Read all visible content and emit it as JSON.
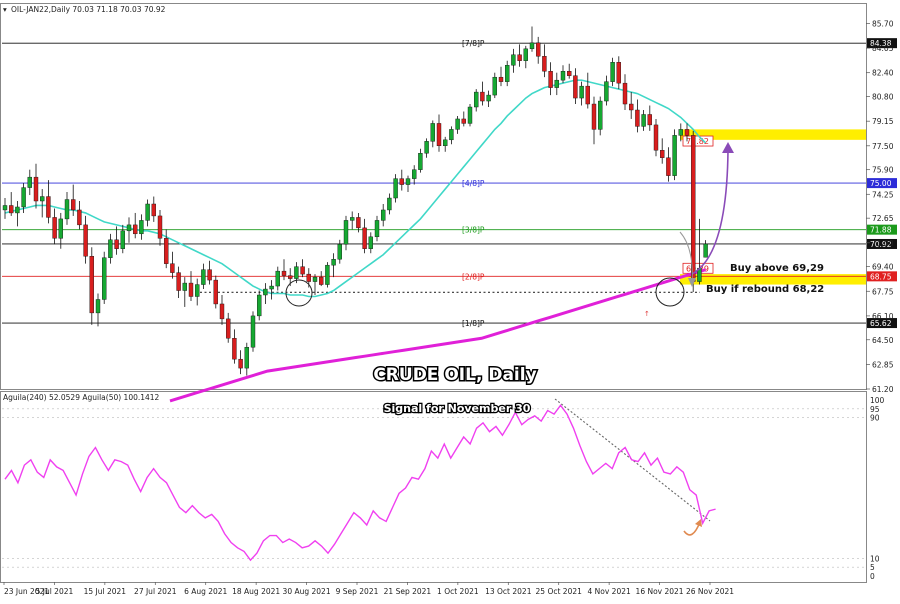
{
  "header": {
    "symbol_line": "OIL-JAN22,Daily  70.03 71.18 70.03 70.92",
    "indicator_line": "Aguila(240) 52.0529  Aguila(50) 100.1412"
  },
  "overlay": {
    "title": "CRUDE OIL, Daily",
    "subtitle": "Signal for November 30"
  },
  "notes": {
    "buy_above": "Buy above 69,29",
    "buy_rebound": "Buy if rebound 68,22"
  },
  "colors": {
    "bull": "#16a832",
    "bear": "#d81e1e",
    "wick": "#111111",
    "ma_short": "#40d8c8",
    "ma_long": "#e020d8",
    "osc": "#f040f0",
    "highlight": "#ffee00",
    "murray_blue": "#2c2cd8",
    "murray_green": "#1b9a1b",
    "murray_red": "#e02020",
    "arrow_purple": "#8a4bb8",
    "arrow_orange": "#e08a50"
  },
  "chart_data": [
    {
      "type": "candlestick",
      "title": "CRUDE OIL, Daily",
      "symbol": "OIL-JAN22",
      "timeframe": "Daily",
      "ylim": [
        61.2,
        86.2
      ],
      "y_ticks": [
        85.7,
        84.05,
        82.4,
        80.8,
        79.15,
        77.5,
        75.9,
        74.25,
        72.65,
        71.0,
        69.4,
        67.75,
        66.1,
        64.5,
        62.85,
        61.2
      ],
      "x_tick_labels": [
        "23 Jun 2021",
        "5 Jul 2021",
        "15 Jul 2021",
        "27 Jul 2021",
        "6 Aug 2021",
        "18 Aug 2021",
        "30 Aug 2021",
        "9 Sep 2021",
        "21 Sep 2021",
        "1 Oct 2021",
        "13 Oct 2021",
        "25 Oct 2021",
        "4 Nov 2021",
        "16 Nov 2021",
        "26 Nov 2021"
      ],
      "candles": [
        [
          73.2,
          74.0,
          72.6,
          73.5
        ],
        [
          73.5,
          74.4,
          72.8,
          73.0
        ],
        [
          73.0,
          73.8,
          72.1,
          73.4
        ],
        [
          73.4,
          75.0,
          73.0,
          74.7
        ],
        [
          74.7,
          75.9,
          74.2,
          75.4
        ],
        [
          75.4,
          76.3,
          73.3,
          73.8
        ],
        [
          73.8,
          74.6,
          72.7,
          74.1
        ],
        [
          74.1,
          75.2,
          72.3,
          72.7
        ],
        [
          72.7,
          73.3,
          70.9,
          71.3
        ],
        [
          71.3,
          73.0,
          70.6,
          72.6
        ],
        [
          72.6,
          74.4,
          72.2,
          73.9
        ],
        [
          73.9,
          74.9,
          72.8,
          73.2
        ],
        [
          73.2,
          73.8,
          71.9,
          72.2
        ],
        [
          72.2,
          72.8,
          69.6,
          70.1
        ],
        [
          70.1,
          70.7,
          65.5,
          66.3
        ],
        [
          66.3,
          67.6,
          65.4,
          67.2
        ],
        [
          67.2,
          70.4,
          66.9,
          70.0
        ],
        [
          70.0,
          71.6,
          69.6,
          71.2
        ],
        [
          71.2,
          72.1,
          70.2,
          70.6
        ],
        [
          70.6,
          72.2,
          70.3,
          71.8
        ],
        [
          71.8,
          72.7,
          71.0,
          72.2
        ],
        [
          72.2,
          73.0,
          71.3,
          71.6
        ],
        [
          71.6,
          72.9,
          71.2,
          72.5
        ],
        [
          72.5,
          73.9,
          72.1,
          73.6
        ],
        [
          73.6,
          74.1,
          72.4,
          72.8
        ],
        [
          72.8,
          73.2,
          70.8,
          71.3
        ],
        [
          71.3,
          71.9,
          69.3,
          69.6
        ],
        [
          69.6,
          70.4,
          68.6,
          69.0
        ],
        [
          69.0,
          69.4,
          67.3,
          67.8
        ],
        [
          67.8,
          68.7,
          66.7,
          68.3
        ],
        [
          68.3,
          69.1,
          67.1,
          67.4
        ],
        [
          67.4,
          68.6,
          66.8,
          68.2
        ],
        [
          68.2,
          69.6,
          67.9,
          69.2
        ],
        [
          69.2,
          69.8,
          68.2,
          68.5
        ],
        [
          68.5,
          68.8,
          66.6,
          66.9
        ],
        [
          66.9,
          67.5,
          65.5,
          65.9
        ],
        [
          65.9,
          66.3,
          64.3,
          64.6
        ],
        [
          64.6,
          65.2,
          62.9,
          63.2
        ],
        [
          63.2,
          63.8,
          62.2,
          62.6
        ],
        [
          62.6,
          64.3,
          62.1,
          64.0
        ],
        [
          64.0,
          66.4,
          63.7,
          66.1
        ],
        [
          66.1,
          67.8,
          65.8,
          67.5
        ],
        [
          67.5,
          68.3,
          66.9,
          67.9
        ],
        [
          67.9,
          68.5,
          67.2,
          68.1
        ],
        [
          68.1,
          69.4,
          67.8,
          69.1
        ],
        [
          69.1,
          69.9,
          68.5,
          68.8
        ],
        [
          68.8,
          69.3,
          68.1,
          68.6
        ],
        [
          68.6,
          69.7,
          68.3,
          69.4
        ],
        [
          69.4,
          69.9,
          68.7,
          68.9
        ],
        [
          68.9,
          69.3,
          68.0,
          68.4
        ],
        [
          68.4,
          68.9,
          67.5,
          68.7
        ],
        [
          68.7,
          69.1,
          68.1,
          68.2
        ],
        [
          68.2,
          69.7,
          68.0,
          69.5
        ],
        [
          69.5,
          70.3,
          68.7,
          69.9
        ],
        [
          69.9,
          71.2,
          69.6,
          70.9
        ],
        [
          70.9,
          72.8,
          70.5,
          72.5
        ],
        [
          72.5,
          73.1,
          71.9,
          72.7
        ],
        [
          72.7,
          73.0,
          71.7,
          72.0
        ],
        [
          72.0,
          72.6,
          70.3,
          70.6
        ],
        [
          70.6,
          71.7,
          70.3,
          71.4
        ],
        [
          71.4,
          72.8,
          71.1,
          72.5
        ],
        [
          72.5,
          73.6,
          72.1,
          73.2
        ],
        [
          73.2,
          74.3,
          72.9,
          74.0
        ],
        [
          74.0,
          75.6,
          73.7,
          75.3
        ],
        [
          75.3,
          75.9,
          74.5,
          74.9
        ],
        [
          74.9,
          75.5,
          74.4,
          75.3
        ],
        [
          75.3,
          76.2,
          74.9,
          75.9
        ],
        [
          75.9,
          77.3,
          75.7,
          77.0
        ],
        [
          77.0,
          78.0,
          76.7,
          77.8
        ],
        [
          77.8,
          79.2,
          77.4,
          79.0
        ],
        [
          79.0,
          79.6,
          77.1,
          77.5
        ],
        [
          77.5,
          78.1,
          77.1,
          77.9
        ],
        [
          77.9,
          78.8,
          77.6,
          78.6
        ],
        [
          78.6,
          79.5,
          78.3,
          79.3
        ],
        [
          79.3,
          79.8,
          78.8,
          79.0
        ],
        [
          79.0,
          80.3,
          78.8,
          80.1
        ],
        [
          80.1,
          81.3,
          79.8,
          81.1
        ],
        [
          81.1,
          81.8,
          80.2,
          80.5
        ],
        [
          80.5,
          81.2,
          80.1,
          80.9
        ],
        [
          80.9,
          82.4,
          80.7,
          82.1
        ],
        [
          82.1,
          82.8,
          81.5,
          81.8
        ],
        [
          81.8,
          83.2,
          81.5,
          82.9
        ],
        [
          82.9,
          84.0,
          82.4,
          83.6
        ],
        [
          83.6,
          84.3,
          82.8,
          83.2
        ],
        [
          83.2,
          84.2,
          82.7,
          84.0
        ],
        [
          84.0,
          85.5,
          83.8,
          84.4
        ],
        [
          84.4,
          84.8,
          83.0,
          83.5
        ],
        [
          83.5,
          84.3,
          82.1,
          82.5
        ],
        [
          82.5,
          83.1,
          80.9,
          81.4
        ],
        [
          81.4,
          82.4,
          80.9,
          81.9
        ],
        [
          81.9,
          82.9,
          81.7,
          82.5
        ],
        [
          82.5,
          83.0,
          82.0,
          82.2
        ],
        [
          82.2,
          82.7,
          80.3,
          80.7
        ],
        [
          80.7,
          81.8,
          80.2,
          81.5
        ],
        [
          81.5,
          82.4,
          80.0,
          80.3
        ],
        [
          80.3,
          80.8,
          77.6,
          78.6
        ],
        [
          78.6,
          80.8,
          78.2,
          80.5
        ],
        [
          80.5,
          82.2,
          80.2,
          81.8
        ],
        [
          81.8,
          83.4,
          81.5,
          83.1
        ],
        [
          83.1,
          83.5,
          81.3,
          81.7
        ],
        [
          81.7,
          82.3,
          79.9,
          80.3
        ],
        [
          80.3,
          81.1,
          79.3,
          79.9
        ],
        [
          79.9,
          80.6,
          78.4,
          78.8
        ],
        [
          78.8,
          79.9,
          78.5,
          79.6
        ],
        [
          79.6,
          80.2,
          78.5,
          78.9
        ],
        [
          78.9,
          79.3,
          76.8,
          77.2
        ],
        [
          77.2,
          78.0,
          76.3,
          76.7
        ],
        [
          76.7,
          77.4,
          75.1,
          75.5
        ],
        [
          75.5,
          78.6,
          75.2,
          78.2
        ],
        [
          78.2,
          79.0,
          77.8,
          78.6
        ],
        [
          78.6,
          79.0,
          77.8,
          78.2
        ],
        [
          78.2,
          78.5,
          67.7,
          68.4
        ],
        [
          68.4,
          72.6,
          68.2,
          69.3
        ],
        [
          70.03,
          71.18,
          70.03,
          70.92
        ]
      ],
      "ma_short": [
        73.0,
        73.1,
        73.2,
        73.3,
        73.4,
        73.5,
        73.5,
        73.5,
        73.4,
        73.3,
        73.2,
        73.2,
        73.1,
        73.0,
        72.8,
        72.6,
        72.4,
        72.3,
        72.2,
        72.1,
        72.0,
        71.9,
        71.8,
        71.8,
        71.7,
        71.6,
        71.4,
        71.2,
        71.0,
        70.8,
        70.6,
        70.4,
        70.2,
        70.0,
        69.8,
        69.6,
        69.3,
        69.0,
        68.7,
        68.4,
        68.1,
        67.9,
        67.7,
        67.6,
        67.6,
        67.6,
        67.5,
        67.5,
        67.5,
        67.4,
        67.4,
        67.5,
        67.6,
        67.8,
        68.1,
        68.4,
        68.7,
        69.0,
        69.3,
        69.6,
        69.9,
        70.2,
        70.6,
        71.0,
        71.4,
        71.8,
        72.2,
        72.6,
        73.1,
        73.6,
        74.1,
        74.6,
        75.1,
        75.6,
        76.1,
        76.6,
        77.1,
        77.6,
        78.1,
        78.6,
        79.0,
        79.5,
        79.9,
        80.3,
        80.7,
        81.0,
        81.2,
        81.4,
        81.5,
        81.6,
        81.7,
        81.8,
        81.9,
        81.9,
        81.8,
        81.7,
        81.6,
        81.5,
        81.4,
        81.3,
        81.2,
        81.1,
        81.0,
        80.8,
        80.6,
        80.4,
        80.2,
        80.0,
        79.7,
        79.4,
        79.0,
        78.6,
        78.1,
        77.7
      ],
      "ma_long": [
        60.4,
        60.6,
        60.8,
        61.0,
        61.2,
        61.4,
        61.6,
        61.8,
        62.0,
        62.2,
        62.4,
        62.5,
        62.6,
        62.7,
        62.8,
        62.9,
        63.0,
        63.1,
        63.2,
        63.3,
        63.4,
        63.5,
        63.6,
        63.7,
        63.8,
        63.9,
        64.0,
        64.1,
        64.2,
        64.3,
        64.4,
        64.5,
        64.6,
        64.8,
        65.0,
        65.2,
        65.4,
        65.6,
        65.8,
        66.0,
        66.2,
        66.4,
        66.6,
        66.8,
        67.0,
        67.2,
        67.4,
        67.6,
        67.8,
        68.0,
        68.2,
        68.4,
        68.6,
        68.8,
        69.0,
        69.2
      ],
      "horizontal_levels": [
        {
          "label": "[7/8]P",
          "price": 84.38,
          "tag": "84.38",
          "color": "#111111"
        },
        {
          "label": "[4/8]P",
          "price": 75.0,
          "tag": "75.00",
          "color": "#2c2cd8"
        },
        {
          "label": "[3/8]P",
          "price": 71.88,
          "tag": "71.88",
          "color": "#1b9a1b"
        },
        {
          "label": "",
          "price": 70.92,
          "tag": "70.92",
          "color": "#111111"
        },
        {
          "label": "[2/8]P",
          "price": 68.75,
          "tag": "68.75",
          "color": "#e02020"
        },
        {
          "label": "[1/8]P",
          "price": 65.62,
          "tag": "65.62",
          "color": "#111111"
        }
      ],
      "annotations": [
        {
          "text": "77.82",
          "price": 77.82,
          "color": "#e02020"
        },
        {
          "text": "69.29",
          "price": 69.29,
          "color": "#e02020"
        },
        {
          "text": "Buy above 69,29",
          "price": 69.29
        },
        {
          "text": "Buy if rebound 68,22",
          "price": 68.22
        }
      ],
      "highlight_zones": [
        {
          "from": 77.9,
          "to": 78.6
        },
        {
          "from": 68.2,
          "to": 68.9
        }
      ]
    },
    {
      "type": "line",
      "title": "Aguila(240) 52.0529  Aguila(50) 100.1412",
      "ylim": [
        0,
        100
      ],
      "y_ticks": [
        100,
        95,
        90,
        10,
        5,
        0
      ],
      "values": [
        55,
        60,
        53,
        63,
        66,
        59,
        56,
        66,
        62,
        60,
        53,
        46,
        58,
        68,
        73,
        66,
        60,
        66,
        65,
        63,
        55,
        48,
        56,
        61,
        56,
        53,
        46,
        39,
        36,
        40,
        36,
        33,
        35,
        31,
        24,
        19,
        16,
        14,
        9,
        13,
        20,
        23,
        23,
        19,
        21,
        19,
        16,
        17,
        20,
        17,
        13,
        18,
        24,
        30,
        36,
        33,
        29,
        37,
        33,
        31,
        39,
        47,
        50,
        56,
        55,
        61,
        71,
        67,
        75,
        67,
        73,
        79,
        75,
        84,
        87,
        82,
        85,
        80,
        86,
        93,
        86,
        89,
        91,
        88,
        94,
        92,
        97,
        92,
        84,
        74,
        65,
        58,
        61,
        64,
        61,
        70,
        73,
        66,
        65,
        70,
        63,
        67,
        59,
        58,
        62,
        59,
        49,
        46,
        30,
        37,
        38
      ]
    }
  ]
}
